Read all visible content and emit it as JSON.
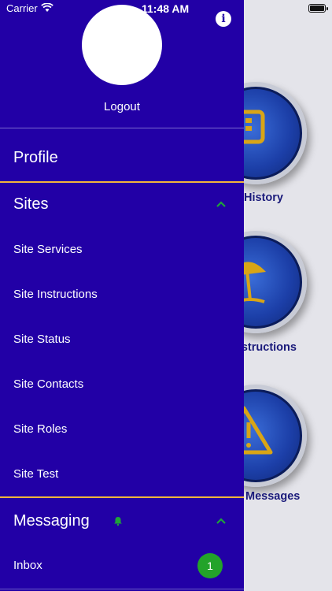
{
  "status_bar": {
    "carrier": "Carrier",
    "time": "11:48 AM"
  },
  "background": {
    "tiles": [
      {
        "label": "History",
        "icon": "keypad-icon"
      },
      {
        "label": "nstructions",
        "icon": "umbrella-icon"
      },
      {
        "label": "Messages",
        "icon": "warning-icon"
      }
    ]
  },
  "drawer": {
    "logout_label": "Logout",
    "profile_label": "Profile",
    "sites": {
      "label": "Sites",
      "items": [
        "Site Services",
        "Site Instructions",
        "Site Status",
        "Site Contacts",
        "Site Roles",
        "Site Test"
      ]
    },
    "messaging": {
      "label": "Messaging",
      "inbox_label": "Inbox",
      "inbox_count": "1"
    }
  },
  "colors": {
    "drawer_bg": "#2200a6",
    "separator_gold": "#f2b43c",
    "chevron_green": "#1fa33a",
    "badge_green": "#23a32a"
  }
}
